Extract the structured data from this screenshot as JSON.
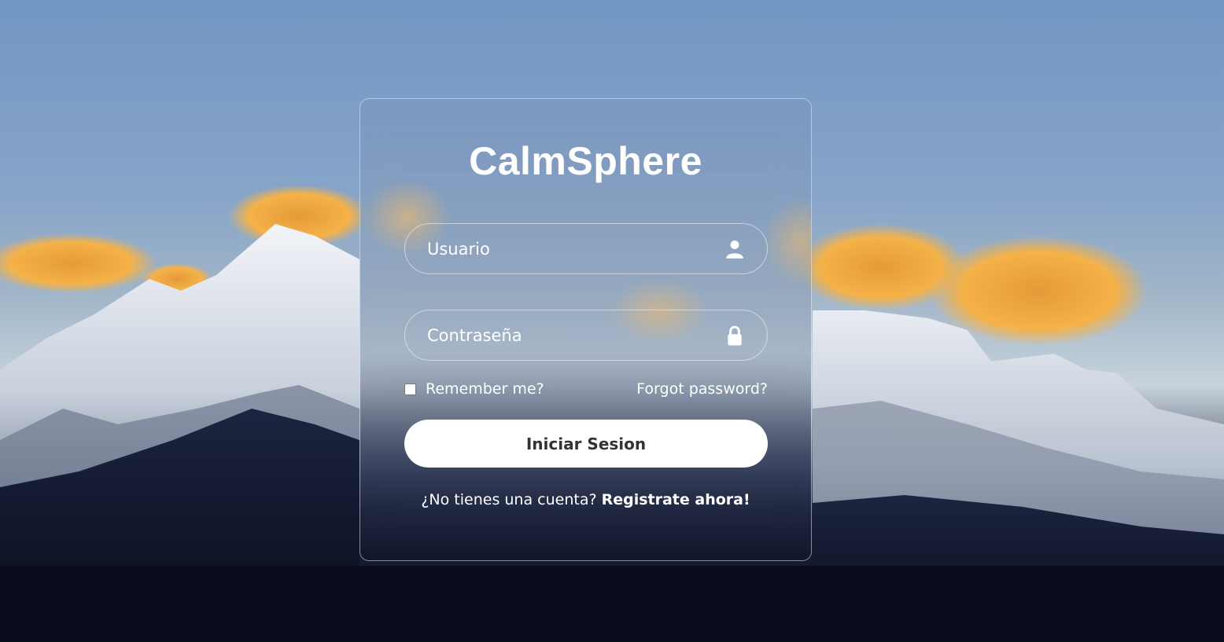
{
  "brand": {
    "title": "CalmSphere"
  },
  "form": {
    "username_placeholder": "Usuario",
    "password_placeholder": "Contraseña",
    "username_icon": "user-icon",
    "password_icon": "lock-icon",
    "remember_label": "Remember me?",
    "remember_checked": false,
    "forgot_label": "Forgot password?",
    "submit_label": "Iniciar Sesion",
    "register_prompt": "¿No tienes una cuenta?",
    "register_link": "Registrate ahora!"
  },
  "colors": {
    "button_bg": "#ffffff",
    "button_text": "#333333",
    "text": "#ffffff"
  }
}
